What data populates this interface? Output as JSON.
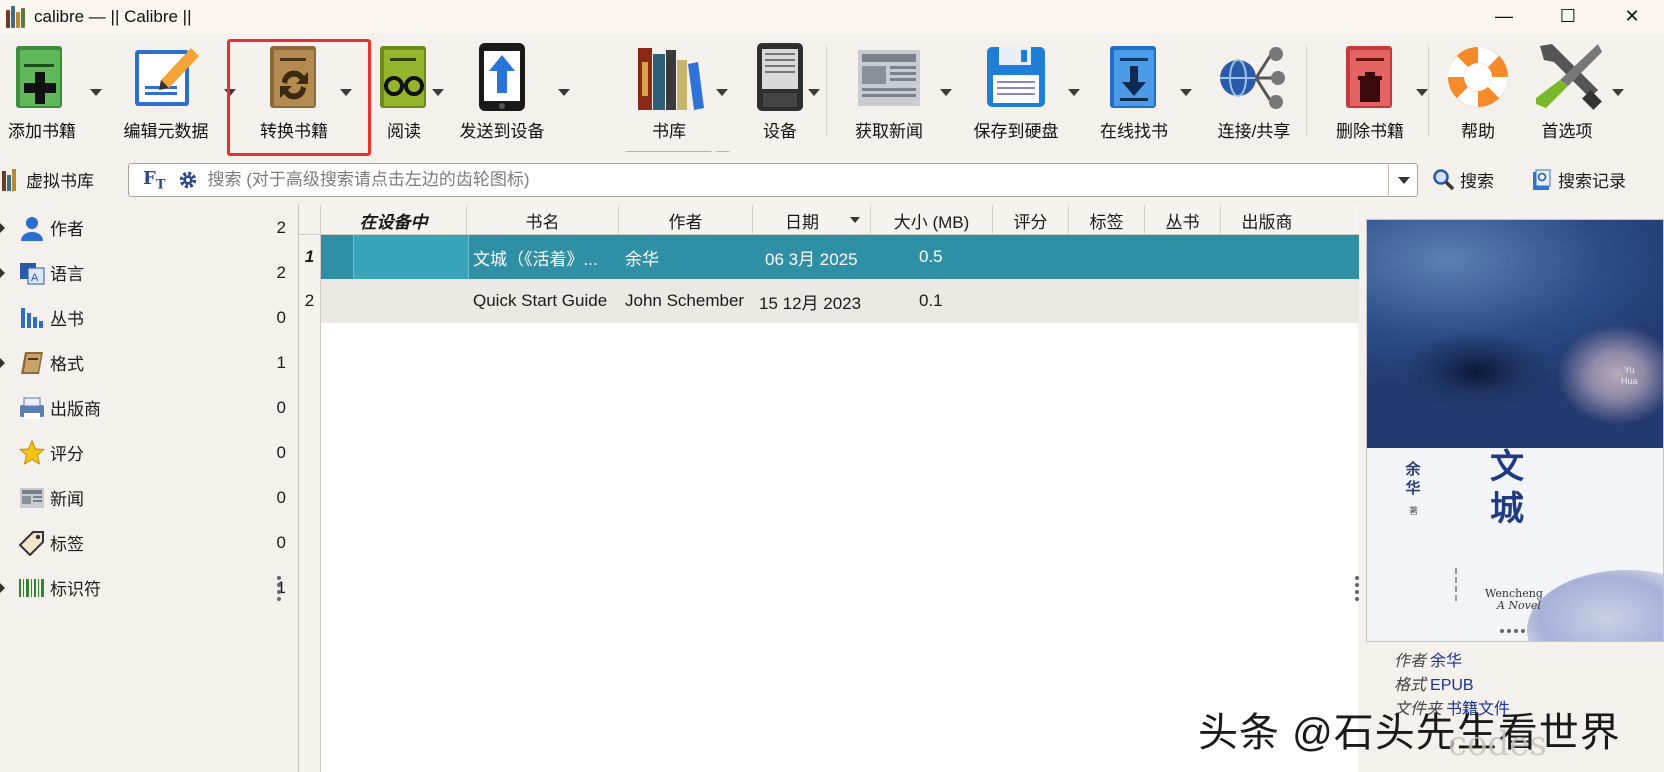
{
  "window": {
    "title": "calibre — || Calibre ||",
    "controls": {
      "minimize": "—",
      "maximize": "☐",
      "close": "✕"
    }
  },
  "toolbar": {
    "items": [
      {
        "label": "添加书籍",
        "icon": "add-book-icon",
        "dropdown": true
      },
      {
        "label": "编辑元数据",
        "icon": "edit-metadata-icon",
        "dropdown": true
      },
      {
        "label": "转换书籍",
        "icon": "convert-book-icon",
        "dropdown": true,
        "highlighted": true
      },
      {
        "label": "阅读",
        "icon": "read-book-icon",
        "dropdown": true
      },
      {
        "label": "发送到设备",
        "icon": "send-to-device-icon",
        "dropdown": true
      },
      {
        "label": "书库",
        "icon": "library-icon",
        "dropdown": true,
        "active": true
      },
      {
        "label": "设备",
        "icon": "device-icon",
        "dropdown": true
      },
      {
        "label": "获取新闻",
        "icon": "fetch-news-icon",
        "dropdown": true
      },
      {
        "label": "保存到硬盘",
        "icon": "save-to-disk-icon",
        "dropdown": true
      },
      {
        "label": "在线找书",
        "icon": "get-books-icon",
        "dropdown": true
      },
      {
        "label": "连接/共享",
        "icon": "connect-share-icon",
        "dropdown": false
      },
      {
        "label": "删除书籍",
        "icon": "remove-books-icon",
        "dropdown": true
      },
      {
        "label": "帮助",
        "icon": "help-icon",
        "dropdown": false
      },
      {
        "label": "首选项",
        "icon": "preferences-icon",
        "dropdown": true
      }
    ],
    "highlight_color": "#e8302f"
  },
  "search": {
    "virtual_library": "虚拟书库",
    "ft_label": "F",
    "ft_sub": "T",
    "placeholder": "搜索 (对于高级搜索请点击左边的齿轮图标)",
    "search_button": "搜索",
    "history_button": "搜索记录"
  },
  "tag_browser": [
    {
      "name": "作者",
      "count": "2",
      "icon": "authors-icon",
      "expandable": true
    },
    {
      "name": "语言",
      "count": "2",
      "icon": "languages-icon",
      "expandable": true
    },
    {
      "name": "丛书",
      "count": "0",
      "icon": "series-icon",
      "expandable": false
    },
    {
      "name": "格式",
      "count": "1",
      "icon": "formats-icon",
      "expandable": true
    },
    {
      "name": "出版商",
      "count": "0",
      "icon": "publisher-icon",
      "expandable": false
    },
    {
      "name": "评分",
      "count": "0",
      "icon": "rating-star-icon",
      "expandable": false
    },
    {
      "name": "新闻",
      "count": "0",
      "icon": "news-icon",
      "expandable": false
    },
    {
      "name": "标签",
      "count": "0",
      "icon": "tags-icon",
      "expandable": false
    },
    {
      "name": "标识符",
      "count": "1",
      "icon": "identifiers-barcode-icon",
      "expandable": true
    }
  ],
  "table": {
    "columns": [
      "在设备中",
      "书名",
      "作者",
      "日期",
      "大小 (MB)",
      "评分",
      "标签",
      "丛书",
      "出版商"
    ],
    "rows": [
      {
        "num": "1",
        "title": "文城（《活着》...",
        "author": "余华",
        "date": "06 3月 2025",
        "size": "0.5",
        "selected": true
      },
      {
        "num": "2",
        "title": "Quick Start Guide",
        "author": "John Schember",
        "date": "15 12月 2023",
        "size": "0.1",
        "selected": false
      }
    ],
    "selected_color": "#2f8fa4"
  },
  "cover": {
    "author_en": "Yu\nHua",
    "author_cn_1": "余",
    "author_cn_2": "华",
    "author_suffix": "著",
    "title_cn_1": "文",
    "title_cn_2": "城",
    "title_en": "Wencheng",
    "subtitle_en": "A Novel"
  },
  "details": {
    "author_label": "作者",
    "author_value": "余华",
    "format_label": "格式",
    "format_value": "EPUB",
    "file_label": "文件夹",
    "file_value": "书籍文件"
  },
  "watermark": {
    "text": "头条 @石头先生看世界",
    "sub": "codes"
  }
}
